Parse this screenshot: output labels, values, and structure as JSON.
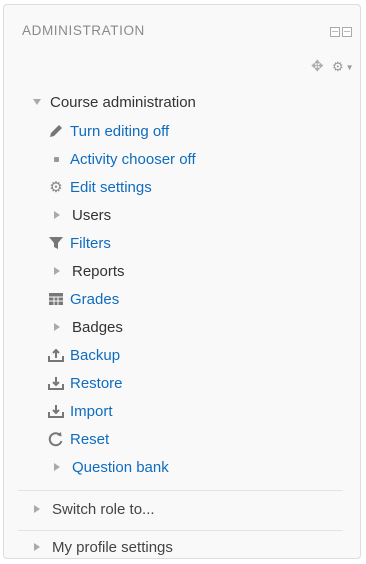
{
  "block": {
    "title": "ADMINISTRATION",
    "icons": {
      "dock": "dock-icon",
      "move": "move-icon",
      "settings": "gear-icon"
    }
  },
  "course_admin": {
    "label": "Course administration",
    "items": [
      {
        "label": "Turn editing off",
        "icon": "pencil-icon",
        "link": true
      },
      {
        "label": "Activity chooser off",
        "icon": "bullet-icon",
        "link": true
      },
      {
        "label": "Edit settings",
        "icon": "gear-icon",
        "link": true
      },
      {
        "label": "Users",
        "icon": "expand-icon",
        "link": false
      },
      {
        "label": "Filters",
        "icon": "filter-icon",
        "link": true
      },
      {
        "label": "Reports",
        "icon": "expand-icon",
        "link": false
      },
      {
        "label": "Grades",
        "icon": "grades-table-icon",
        "link": true
      },
      {
        "label": "Badges",
        "icon": "expand-icon",
        "link": false
      },
      {
        "label": "Backup",
        "icon": "backup-icon",
        "link": true
      },
      {
        "label": "Restore",
        "icon": "restore-icon",
        "link": true
      },
      {
        "label": "Import",
        "icon": "import-icon",
        "link": true
      },
      {
        "label": "Reset",
        "icon": "reset-icon",
        "link": true
      },
      {
        "label": "Question bank",
        "icon": "expand-icon",
        "link": true
      }
    ]
  },
  "switch_role": {
    "label": "Switch role to..."
  },
  "profile_settings": {
    "label": "My profile settings"
  },
  "colors": {
    "link": "#0f6cbf",
    "text": "#333333",
    "muted": "#8a8a8a"
  }
}
